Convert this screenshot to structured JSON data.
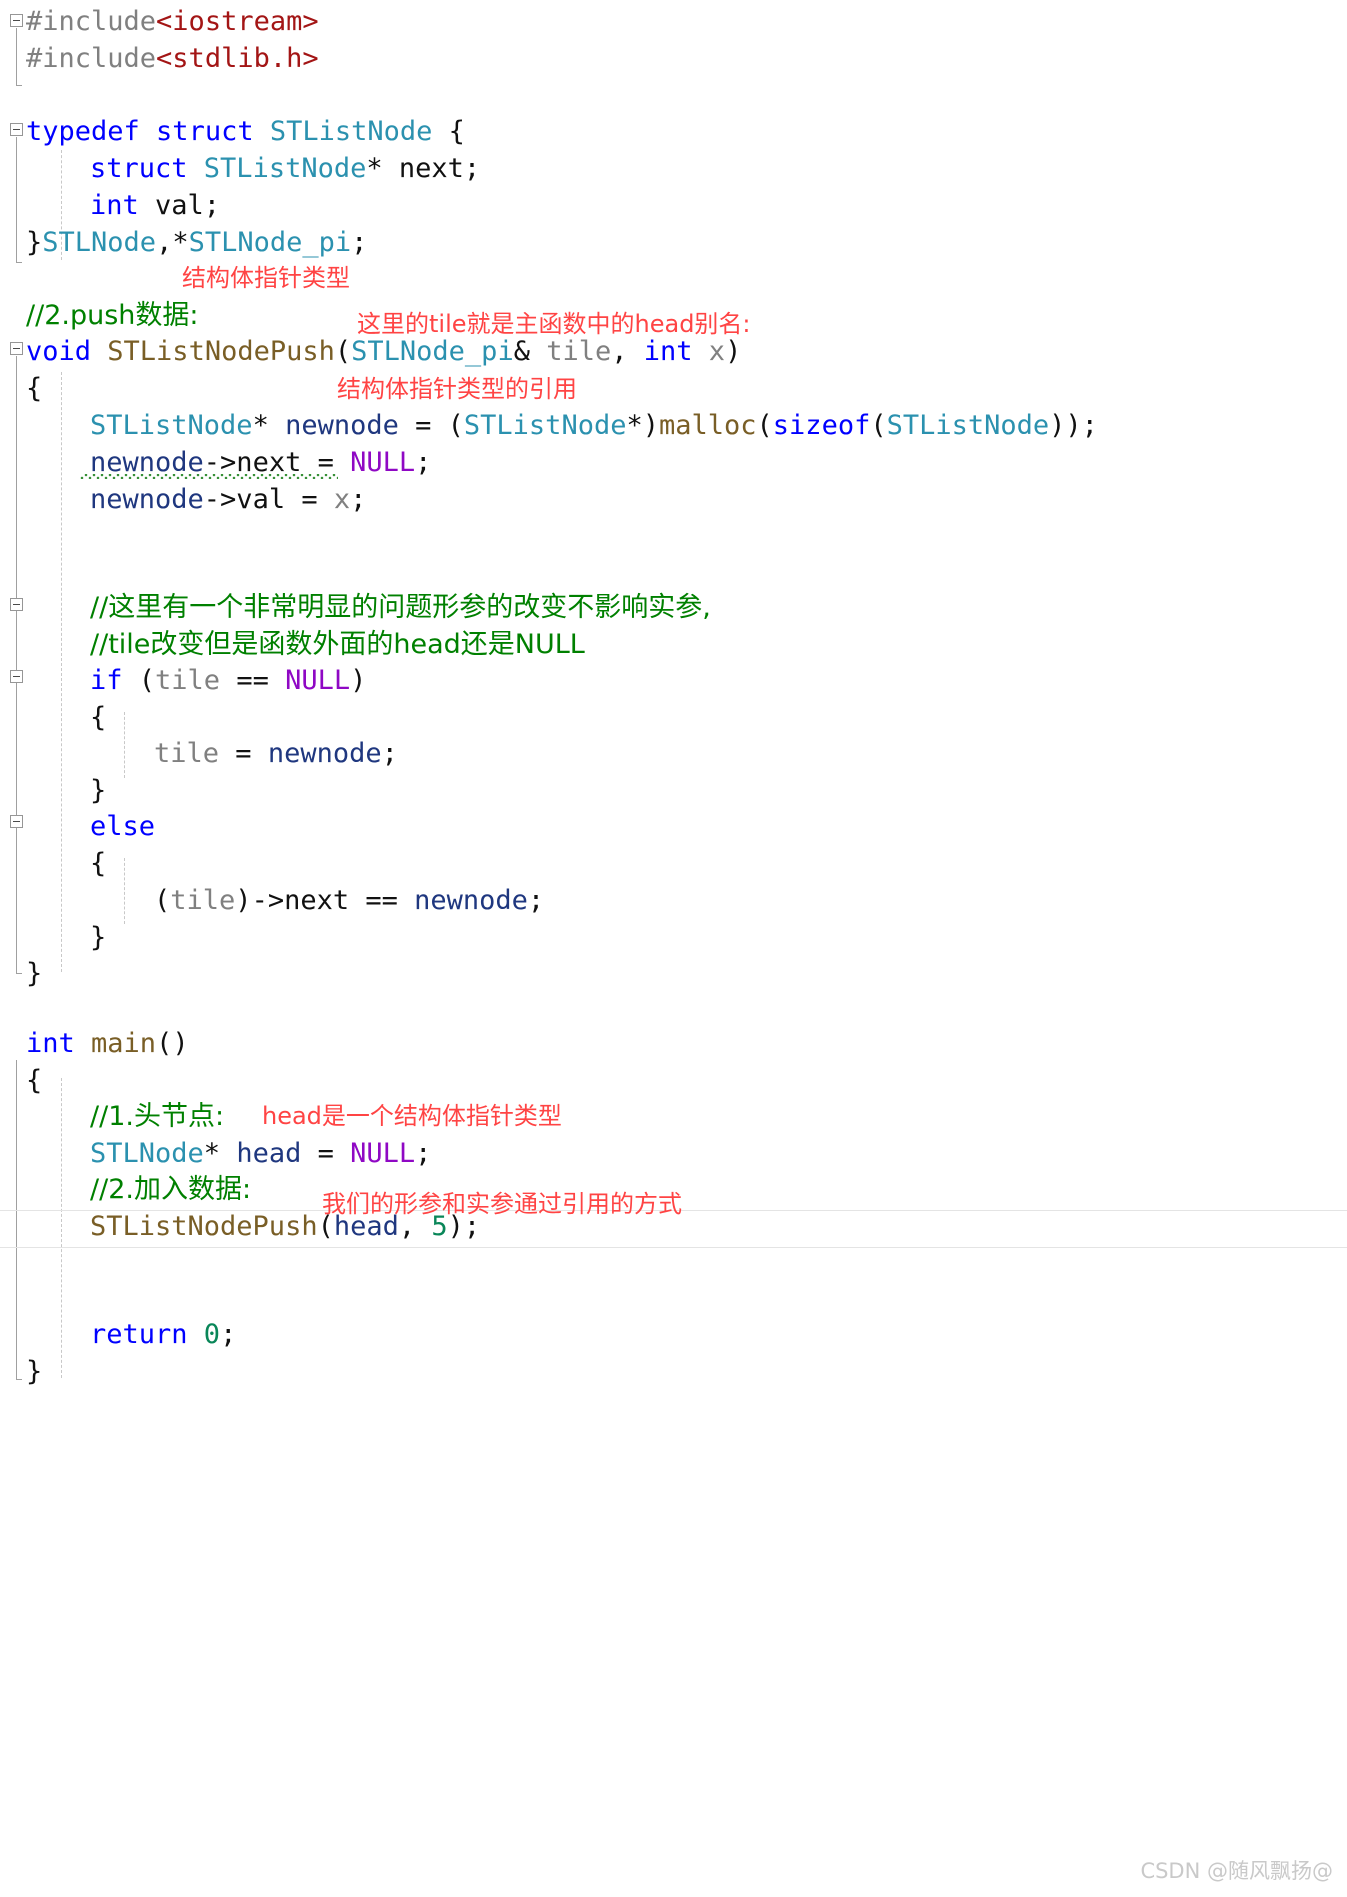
{
  "app": {
    "kind": "code-editor-screenshot",
    "language": "C++"
  },
  "code_lines": [
    {
      "indent": 0,
      "text": "#include<iostream>"
    },
    {
      "indent": 0,
      "text": "#include<stdlib.h>"
    },
    {
      "indent": 0,
      "text": ""
    },
    {
      "indent": 0,
      "text": "typedef struct STListNode {"
    },
    {
      "indent": 1,
      "text": "struct STListNode* next;"
    },
    {
      "indent": 1,
      "text": "int val;"
    },
    {
      "indent": 0,
      "text": "}STLNode,*STLNode_pi;"
    },
    {
      "indent": 0,
      "text": "//2.push数据:"
    },
    {
      "indent": 0,
      "text": "void STListNodePush(STLNode_pi& tile, int x)"
    },
    {
      "indent": 0,
      "text": "{"
    },
    {
      "indent": 1,
      "text": "STListNode* newnode = (STListNode*)malloc(sizeof(STListNode));"
    },
    {
      "indent": 1,
      "text": "newnode->next = NULL;"
    },
    {
      "indent": 1,
      "text": "newnode->val = x;"
    },
    {
      "indent": 0,
      "text": ""
    },
    {
      "indent": 0,
      "text": ""
    },
    {
      "indent": 1,
      "text": "//这里有一个非常明显的问题形参的改变不影响实参,"
    },
    {
      "indent": 1,
      "text": "//tile改变但是函数外面的head还是NULL"
    },
    {
      "indent": 1,
      "text": "if (tile == NULL)"
    },
    {
      "indent": 1,
      "text": "{"
    },
    {
      "indent": 2,
      "text": "tile = newnode;"
    },
    {
      "indent": 1,
      "text": "}"
    },
    {
      "indent": 1,
      "text": "else"
    },
    {
      "indent": 1,
      "text": "{"
    },
    {
      "indent": 2,
      "text": "(tile)->next == newnode;"
    },
    {
      "indent": 1,
      "text": "}"
    },
    {
      "indent": 0,
      "text": "}"
    },
    {
      "indent": 0,
      "text": ""
    },
    {
      "indent": 0,
      "text": "int main()"
    },
    {
      "indent": 0,
      "text": "{"
    },
    {
      "indent": 1,
      "text": "//1.头节点:"
    },
    {
      "indent": 1,
      "text": "STLNode* head = NULL;"
    },
    {
      "indent": 1,
      "text": "//2.加入数据:"
    },
    {
      "indent": 1,
      "text": "STListNodePush(head, 5);"
    },
    {
      "indent": 0,
      "text": ""
    },
    {
      "indent": 0,
      "text": ""
    },
    {
      "indent": 1,
      "text": "return 0;"
    },
    {
      "indent": 0,
      "text": "}"
    }
  ],
  "tokens": {
    "l0_pre": "#include",
    "l0_hdr": "<iostream>",
    "l1_pre": "#include",
    "l1_hdr": "<stdlib.h>",
    "l3_kw1": "typedef",
    "l3_kw2": " struct ",
    "l3_type": "STListNode",
    "l3_brace": " {",
    "l4_kw": "struct ",
    "l4_type": "STListNode",
    "l4_star": "* ",
    "l4_name": "next;",
    "l5_kw": "int",
    "l5_name": " val;",
    "l6_brace": "}",
    "l6_type1": "STLNode",
    "l6_comma": ",*",
    "l6_type2": "STLNode_pi",
    "l6_semi": ";",
    "l7_cmt": "//2.push数据:",
    "l8_kw": "void",
    "l8_fn": " STListNodePush",
    "l8_p1": "(",
    "l8_type": "STLNode_pi",
    "l8_amp": "& ",
    "l8_arg1": "tile",
    "l8_comma": ", ",
    "l8_kw2": "int",
    "l8_arg2": " x",
    "l8_p2": ")",
    "l9_brace": "{",
    "l10_type1": "STListNode",
    "l10_star": "* ",
    "l10_var": "newnode",
    "l10_eq": " = (",
    "l10_type2": "STListNode",
    "l10_cast": "*)",
    "l10_fn": "malloc",
    "l10_p1": "(",
    "l10_kw": "sizeof",
    "l10_p2": "(",
    "l10_type3": "STListNode",
    "l10_tail": "));",
    "l11_var": "newnode",
    "l11_arrow": "->next = ",
    "l11_null": "NULL",
    "l11_semi": ";",
    "l12_var": "newnode",
    "l12_arrow": "->val = ",
    "l12_x": "x",
    "l12_semi": ";",
    "l15_cmt": "//这里有一个非常明显的问题形参的改变不影响实参,",
    "l16_cmt": "//tile改变但是函数外面的head还是NULL",
    "l17_kw": "if",
    "l17_p1": " (",
    "l17_arg": "tile",
    "l17_eq": " == ",
    "l17_null": "NULL",
    "l17_p2": ")",
    "l18_brace": "{",
    "l19_arg": "tile",
    "l19_eq": " = ",
    "l19_var": "newnode",
    "l19_semi": ";",
    "l20_brace": "}",
    "l21_kw": "else",
    "l22_brace": "{",
    "l23_p1": "(",
    "l23_arg": "tile",
    "l23_p2": ")",
    "l23_arrow": "->next == ",
    "l23_var": "newnode",
    "l23_semi": ";",
    "l24_brace": "}",
    "l25_brace": "}",
    "l27_kw": "int",
    "l27_fn": " main",
    "l27_p": "()",
    "l28_brace": "{",
    "l29_cmt": "//1.头节点:",
    "l30_type": "STLNode",
    "l30_star": "* ",
    "l30_var": "head",
    "l30_eq": " = ",
    "l30_null": "NULL",
    "l30_semi": ";",
    "l31_cmt": "//2.加入数据:",
    "l32_fn": "STListNodePush",
    "l32_p1": "(",
    "l32_var": "head",
    "l32_comma": ", ",
    "l32_num": "5",
    "l32_p2": ");",
    "l35_kw": "return",
    "l35_num": " 0",
    "l35_semi": ";",
    "l36_brace": "}"
  },
  "annotations": [
    {
      "id": "annot-struct-pointer-type",
      "text": "结构体指针类型"
    },
    {
      "id": "annot-tile-is-head-alias",
      "text": "这里的tile就是主函数中的head别名:"
    },
    {
      "id": "annot-reference-of-pointer",
      "text": "结构体指针类型的引用"
    },
    {
      "id": "annot-head-is-pointer-type",
      "text": "head是一个结构体指针类型"
    },
    {
      "id": "annot-pass-by-reference",
      "text": "我们的形参和实参通过引用的方式"
    }
  ],
  "colors": {
    "keyword": "#0000ff",
    "preprocessor": "#808080",
    "header_string": "#a31515",
    "type": "#2b91af",
    "function": "#795e26",
    "variable": "#1f377f",
    "parameter": "#808080",
    "macro": "#8f08c4",
    "comment": "#008000",
    "annotation_red": "#ff4444",
    "number": "#098658",
    "background": "#ffffff",
    "watermark": "#c9c9c9"
  },
  "watermark": {
    "text": "CSDN @随风飘扬@"
  }
}
